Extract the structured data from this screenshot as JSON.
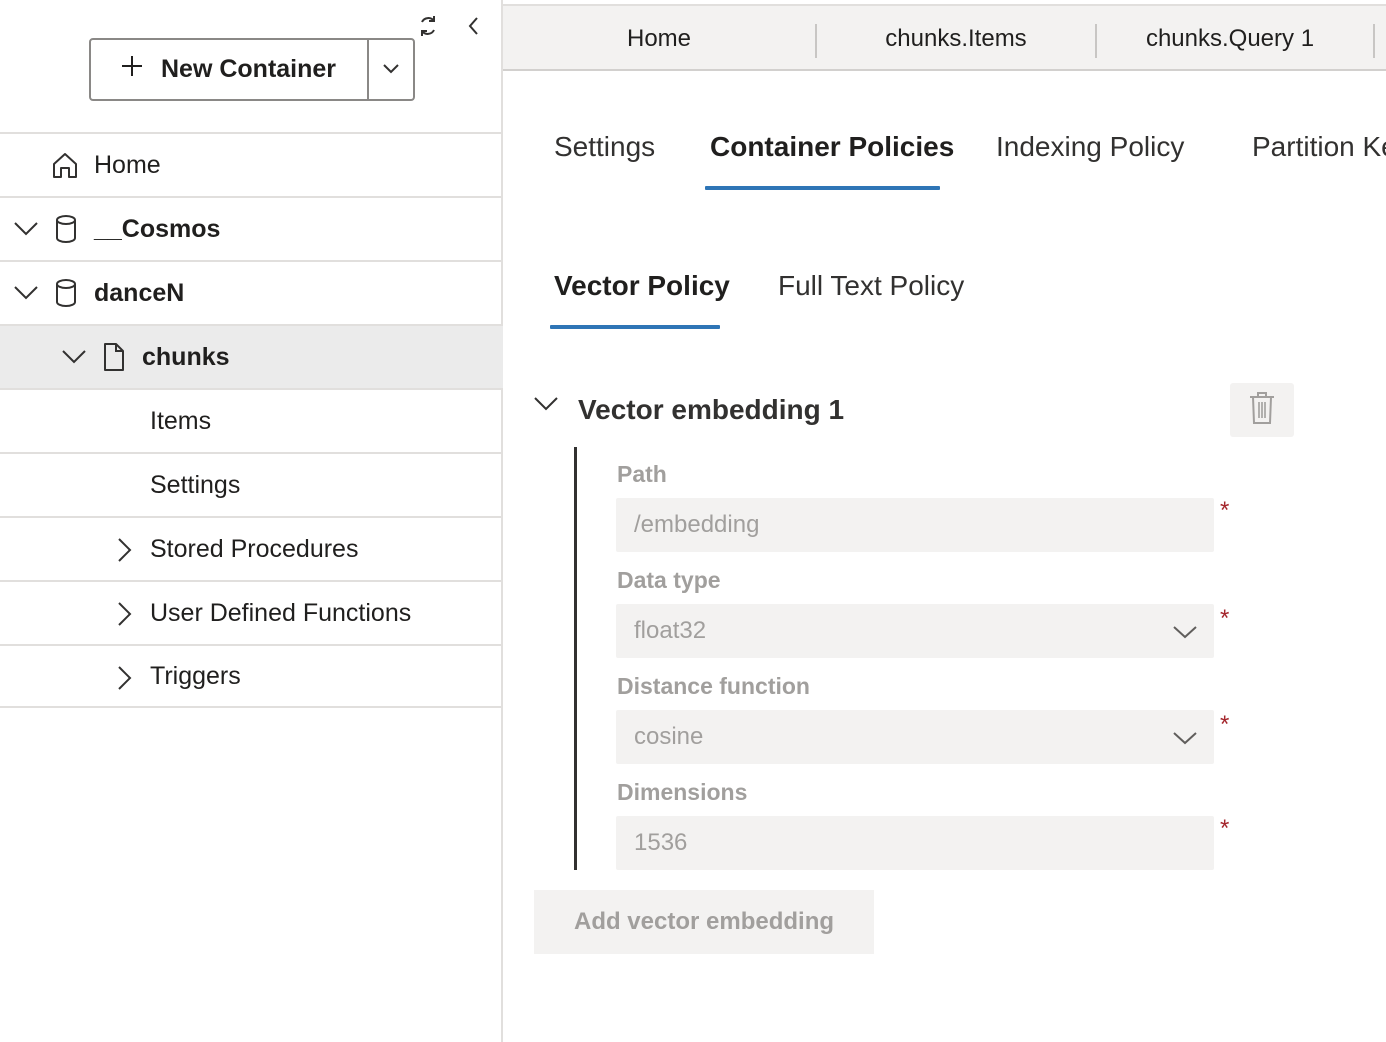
{
  "sidebar": {
    "new_container_label": "New Container",
    "tree": [
      {
        "label": "Home"
      },
      {
        "label": "__Cosmos"
      },
      {
        "label": "danceN"
      },
      {
        "label": "chunks"
      },
      {
        "label": "Items"
      },
      {
        "label": "Settings"
      },
      {
        "label": "Stored Procedures"
      },
      {
        "label": "User Defined Functions"
      },
      {
        "label": "Triggers"
      }
    ]
  },
  "tabs": [
    {
      "label": "Home"
    },
    {
      "label": "chunks.Items"
    },
    {
      "label": "chunks.Query 1"
    }
  ],
  "settings_tabs": [
    {
      "label": "Settings"
    },
    {
      "label": "Container Policies"
    },
    {
      "label": "Indexing Policy"
    },
    {
      "label": "Partition Ke"
    }
  ],
  "policy_tabs": [
    {
      "label": "Vector Policy"
    },
    {
      "label": "Full Text Policy"
    }
  ],
  "embedding": {
    "title": "Vector embedding 1",
    "path_label": "Path",
    "path_value": "/embedding",
    "data_type_label": "Data type",
    "data_type_value": "float32",
    "distance_label": "Distance function",
    "distance_value": "cosine",
    "dimensions_label": "Dimensions",
    "dimensions_value": "1536",
    "required_marker": "*"
  },
  "add_embedding_label": "Add vector embedding",
  "colors": {
    "accent": "#2e75b6",
    "required": "#a4262c",
    "disabled_text": "#a19f9d",
    "selected_row": "#ebebeb"
  }
}
